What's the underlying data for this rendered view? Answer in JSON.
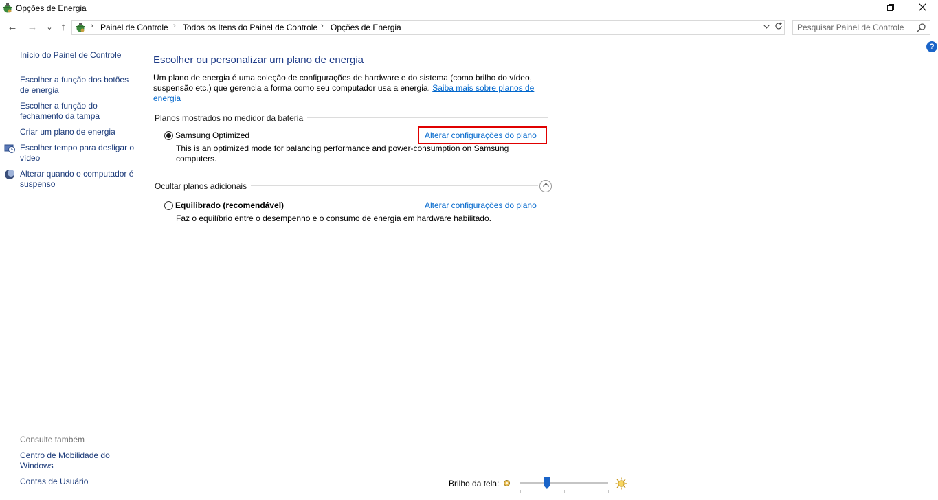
{
  "window": {
    "title": "Opções de Energia",
    "minimize_icon": "minimize-icon",
    "maximize_icon": "restore-icon",
    "close_icon": "close-icon"
  },
  "navigation": {
    "back": "←",
    "forward": "→",
    "recent": "⌄",
    "up": "↑",
    "breadcrumb": [
      "Painel de Controle",
      "Todos os Itens do Painel de Controle",
      "Opções de Energia"
    ],
    "search_placeholder": "Pesquisar Painel de Controle"
  },
  "sidebar": {
    "home_link": "Início do Painel de Controle",
    "links": [
      {
        "label": "Escolher a função dos botões de energia",
        "icon": null
      },
      {
        "label": "Escolher a função do fechamento da tampa",
        "icon": null
      },
      {
        "label": "Criar um plano de energia",
        "icon": null
      },
      {
        "label": "Escolher tempo para desligar o vídeo",
        "icon": "display-clock-icon"
      },
      {
        "label": "Alterar quando o computador é suspenso",
        "icon": "moon-icon"
      }
    ],
    "see_also_title": "Consulte também",
    "see_also": [
      "Centro de Mobilidade do Windows",
      "Contas de Usuário"
    ]
  },
  "main": {
    "heading": "Escolher ou personalizar um plano de energia",
    "intro_text": "Um plano de energia é uma coleção de configurações de hardware e do sistema (como brilho do vídeo, suspensão etc.) que gerencia a forma como seu computador usa a energia.",
    "intro_link": "Saiba mais sobre planos de energia",
    "battery_section_title": "Planos mostrados no medidor da bateria",
    "plans_shown": [
      {
        "name": "Samsung Optimized",
        "selected": true,
        "link": "Alterar configurações do plano",
        "description": "This is an optimized mode for balancing performance and power-consumption on Samsung computers."
      }
    ],
    "additional_section_title": "Ocultar planos adicionais",
    "additional_plans": [
      {
        "name": "Equilibrado (recomendável)",
        "selected": false,
        "link": "Alterar configurações do plano",
        "description": "Faz o equilíbrio entre o desempenho e o consumo de energia em hardware habilitado."
      }
    ]
  },
  "footer": {
    "brightness_label": "Brilho da tela:",
    "brightness_level": 0.3
  },
  "colors": {
    "link": "#0066cc",
    "heading": "#1e3b87",
    "highlight": "#e00000",
    "accent": "#1a64c8"
  }
}
